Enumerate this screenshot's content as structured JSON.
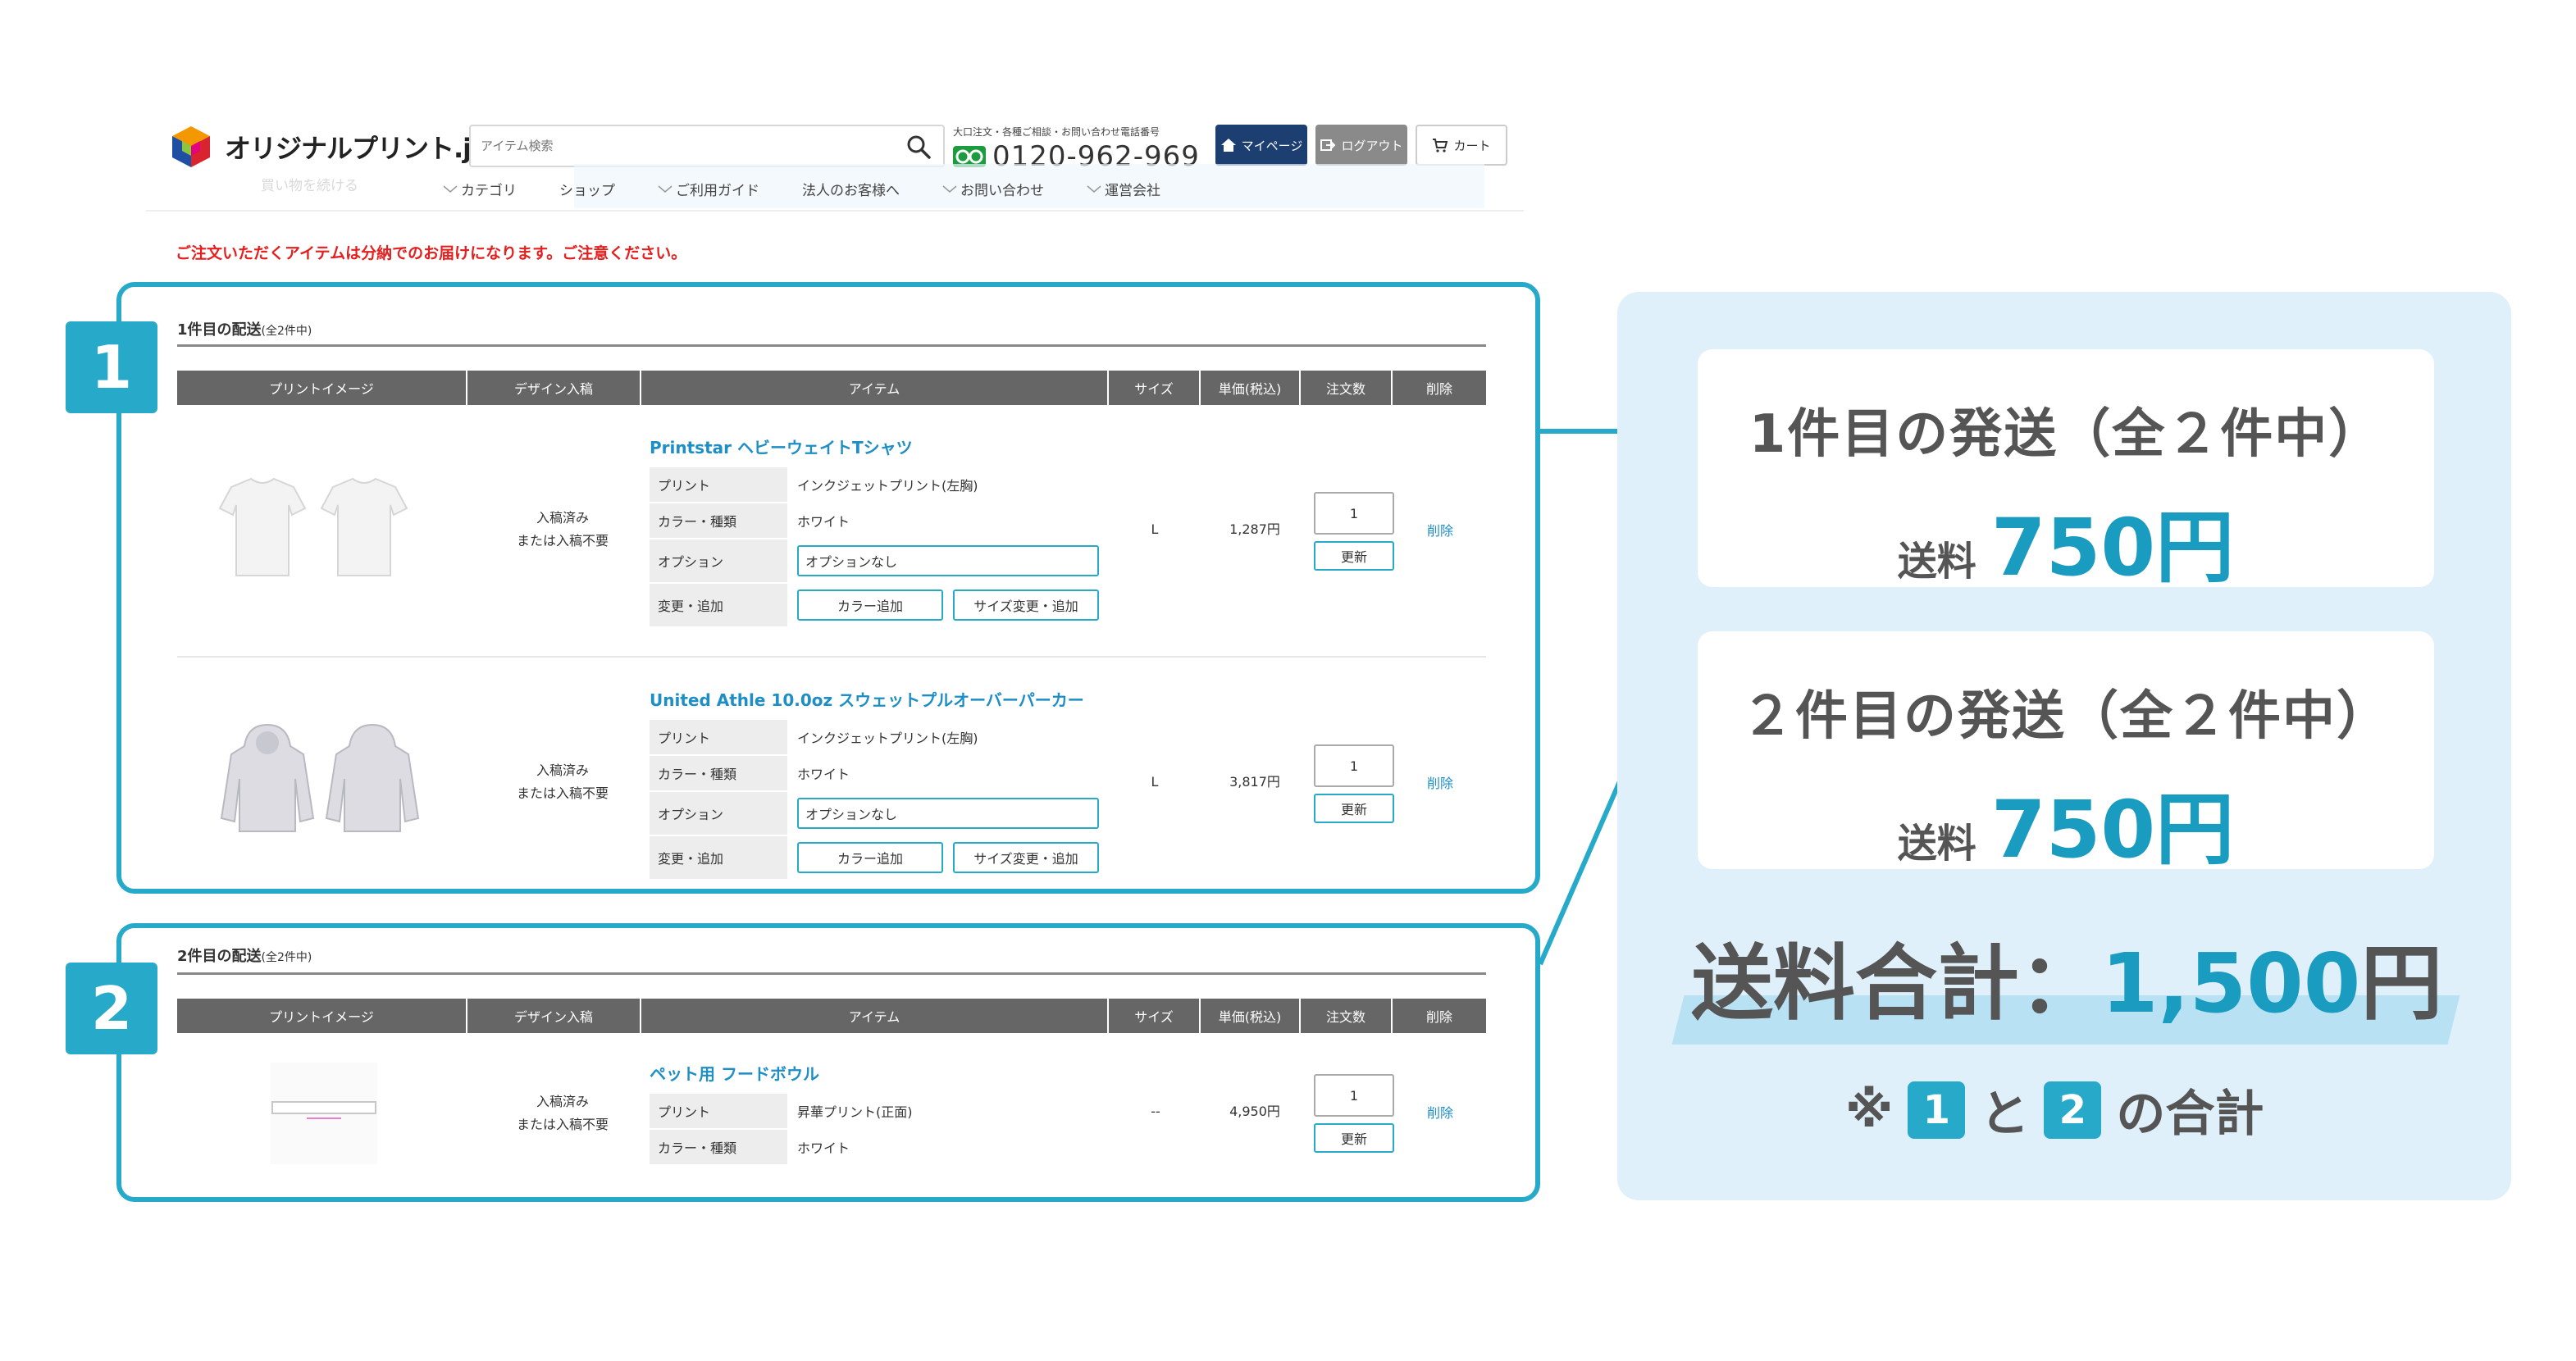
{
  "header": {
    "logo_text": "オリジナルプリント.jp",
    "search_placeholder": "アイテム検索",
    "phone_note": "大口注文・各種ご相談・お問い合わせ電話番号",
    "phone_number": "0120-962-969",
    "mypage_label": "マイページ",
    "logout_label": "ログアウト",
    "cart_label": "カート",
    "ghost_text": "買い物を続ける",
    "nav": [
      "カテゴリ",
      "ショップ",
      "ご利用ガイド",
      "法人のお客様へ",
      "お問い合わせ",
      "運営会社"
    ]
  },
  "notice": "ご注文いただくアイテムは分納でのお届けになります。ご注意ください。",
  "table_headers": [
    "プリントイメージ",
    "デザイン入稿",
    "アイテム",
    "サイズ",
    "単価(税込)",
    "注文数",
    "削除"
  ],
  "shipments": [
    {
      "badge": "1",
      "title": "1件目の配送",
      "title_note": "(全2件中)",
      "items": [
        {
          "name": "Printstar ヘビーウェイトTシャツ",
          "design_line1": "入稿済み",
          "design_line2": "または入稿不要",
          "options": {
            "print_label": "プリント",
            "print_value": "インクジェットプリント(左胸)",
            "color_label": "カラー・種類",
            "color_value": "ホワイト",
            "option_label": "オプション",
            "option_value": "オプションなし",
            "change_label": "変更・追加",
            "color_add": "カラー追加",
            "size_change": "サイズ変更・追加"
          },
          "size": "L",
          "price": "1,287円",
          "qty": "1",
          "update": "更新",
          "delete": "削除"
        },
        {
          "name": "United Athle 10.0oz スウェットプルオーバーパーカー",
          "design_line1": "入稿済み",
          "design_line2": "または入稿不要",
          "options": {
            "print_label": "プリント",
            "print_value": "インクジェットプリント(左胸)",
            "color_label": "カラー・種類",
            "color_value": "ホワイト",
            "option_label": "オプション",
            "option_value": "オプションなし",
            "change_label": "変更・追加",
            "color_add": "カラー追加",
            "size_change": "サイズ変更・追加"
          },
          "size": "L",
          "price": "3,817円",
          "qty": "1",
          "update": "更新",
          "delete": "削除"
        }
      ]
    },
    {
      "badge": "2",
      "title": "2件目の配送",
      "title_note": "(全2件中)",
      "items": [
        {
          "name": "ペット用 フードボウル",
          "design_line1": "入稿済み",
          "design_line2": "または入稿不要",
          "options": {
            "print_label": "プリント",
            "print_value": "昇華プリント(正面)",
            "color_label": "カラー・種類",
            "color_value": "ホワイト"
          },
          "size": "--",
          "price": "4,950円",
          "qty": "1",
          "update": "更新",
          "delete": "削除"
        }
      ]
    }
  ],
  "summary": {
    "card1_title": "1件目の発送（全２件中）",
    "card2_title": "２件目の発送（全２件中）",
    "fee_label": "送料",
    "fee1_value": "750円",
    "fee2_value": "750円",
    "total_label": "送料合計：",
    "total_value": "1,500",
    "total_unit": " 円",
    "footnote_prefix": "※",
    "footnote_badge1": "1",
    "footnote_mid": "と",
    "footnote_badge2": "2",
    "footnote_suffix": "の合計"
  },
  "colors": {
    "accent": "#27a9c9",
    "price_blue": "#1a9cc0",
    "link_blue": "#1e8ec6",
    "notice_red": "#e51e1e",
    "panel_bg": "#dff0fa",
    "table_header": "#666666"
  }
}
